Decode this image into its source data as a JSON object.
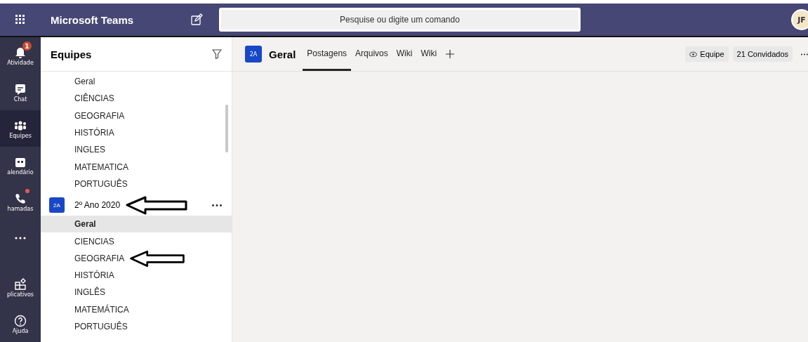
{
  "app_title": "Microsoft Teams",
  "search": {
    "placeholder": "Pesquise ou digite um comando"
  },
  "avatar": "JF",
  "rail": [
    {
      "label": "Atividade",
      "selected": false,
      "badge": "1",
      "dot": false
    },
    {
      "label": "Chat",
      "selected": false,
      "dot": false
    },
    {
      "label": "Equipes",
      "selected": true,
      "dot": false
    },
    {
      "label": "alendário",
      "selected": false,
      "dot": false
    },
    {
      "label": "hamadas",
      "selected": false,
      "dot": true
    },
    {
      "selected": false
    }
  ],
  "rail_bottom": [
    {
      "label": "plicativos",
      "selected": false,
      "dot": false
    },
    {
      "label": "Ajuda",
      "selected": false,
      "dot": false
    }
  ],
  "sidebar": {
    "title": "Equipes",
    "items": [
      {
        "kind": "channel",
        "label": "Geral",
        "selected": false
      },
      {
        "kind": "channel",
        "label": "CIÊNCIAS",
        "selected": false
      },
      {
        "kind": "channel",
        "label": "GEOGRAFIA",
        "selected": false
      },
      {
        "kind": "channel",
        "label": "HISTÓRIA",
        "selected": false
      },
      {
        "kind": "channel",
        "label": "INGLES",
        "selected": false
      },
      {
        "kind": "channel",
        "label": "MATEMATICA",
        "selected": false
      },
      {
        "kind": "channel",
        "label": "PORTUGUÊS",
        "selected": false
      },
      {
        "kind": "team",
        "label": "2º Ano 2020",
        "badge": "2A",
        "arrow": true
      },
      {
        "kind": "channel",
        "label": "Geral",
        "selected": true
      },
      {
        "kind": "channel",
        "label": "CIENCIAS",
        "selected": false
      },
      {
        "kind": "channel",
        "label": "GEOGRAFIA",
        "selected": false,
        "arrow": true
      },
      {
        "kind": "channel",
        "label": "HISTÓRIA",
        "selected": false
      },
      {
        "kind": "channel",
        "label": "INGLÊS",
        "selected": false
      },
      {
        "kind": "channel",
        "label": "MATEMÁTICA",
        "selected": false
      },
      {
        "kind": "channel",
        "label": "PORTUGUÊS",
        "selected": false
      }
    ]
  },
  "channel_header": {
    "badge": "2A",
    "title": "Geral",
    "tabs": [
      {
        "label": "Postagens",
        "selected": true
      },
      {
        "label": "Arquivos",
        "selected": false
      },
      {
        "label": "Wiki",
        "selected": false
      },
      {
        "label": "Wiki",
        "selected": false
      }
    ],
    "team_button": "Equipe",
    "guests_button": "21 Convidados"
  }
}
